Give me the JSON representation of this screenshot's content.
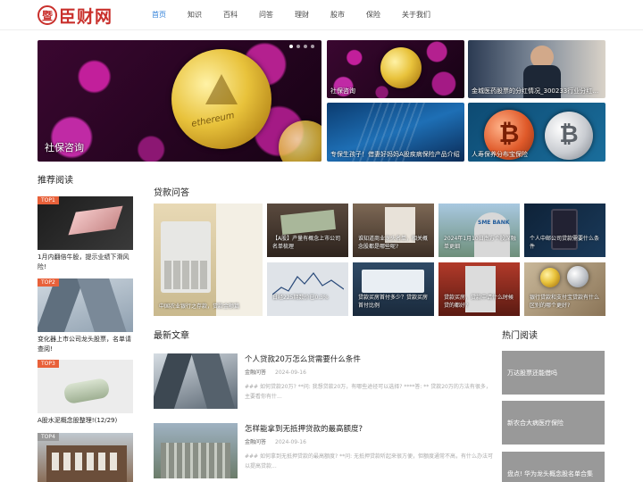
{
  "header": {
    "logo_mark": "暨",
    "logo_text": "臣财网",
    "nav": [
      "首页",
      "知识",
      "百科",
      "问答",
      "理财",
      "股市",
      "保险",
      "关于我们"
    ]
  },
  "hero": {
    "main_caption": "社保咨询",
    "tiles": [
      "社保咨询",
      "金城医药股票的分红情况_300233行业分红排...",
      "专保生孩子！借妻好妈妈A股疾病保险产品介绍",
      "人寿保养分布宝保险"
    ],
    "coin_text": "ethereum"
  },
  "recommend": {
    "title": "推荐阅读",
    "items": [
      {
        "badge": "TOP1",
        "text": "1月内翻倍牛股，提示业绩下滑风险!"
      },
      {
        "badge": "TOP2",
        "text": "变化器上市公司龙头股票，名单请查阅!"
      },
      {
        "badge": "TOP3",
        "text": "A股水泥概念股整理!(12/29)"
      },
      {
        "badge": "TOP4",
        "text": ""
      }
    ]
  },
  "loans": {
    "title": "贷款问答",
    "big_caption": "中国农业银行之存款，贷款金额篇",
    "items": [
      "【A股】产量有概念上市公司名单梳理",
      "谁知道商业龙头名单，相关概念股都是哪些呢?",
      "2024年1月10日南方个股深融单更细",
      "个人中邮公司贷款需要什么条件",
      "日经225期数价已0.3%",
      "贷款买房首付多少？贷款买房首付比例",
      "贷款买房，贷款申请什么时候贷的都好?",
      "银行贷款和支付宝贷款有什么区别的哪个更好?"
    ],
    "sme_sign": "SME BANK"
  },
  "articles": {
    "title": "最新文章",
    "items": [
      {
        "title": "个人贷款20万怎么贷需要什么条件",
        "category": "金融问答",
        "date": "2024-09-16",
        "desc": "### 如何贷款20万? **问: 我想贷款20万，有哪些途径可以选择? ****答: ** 贷款20万的方法有很多，主要看你有什..."
      },
      {
        "title": "怎样能拿到无抵押贷款的最高额度?",
        "category": "金融问答",
        "date": "2024-09-16",
        "desc": "### 如何拿到无抵押贷款的最高额度? **问: 无抵押贷款听起来很方便，但额度通常不高，有什么办法可以提高贷款..."
      }
    ]
  },
  "hot": {
    "title": "热门阅读",
    "items": [
      "万达股票还能借吗",
      "新农合大病医疗保险",
      "盘点! 华为龙头概念股名单合集"
    ]
  }
}
